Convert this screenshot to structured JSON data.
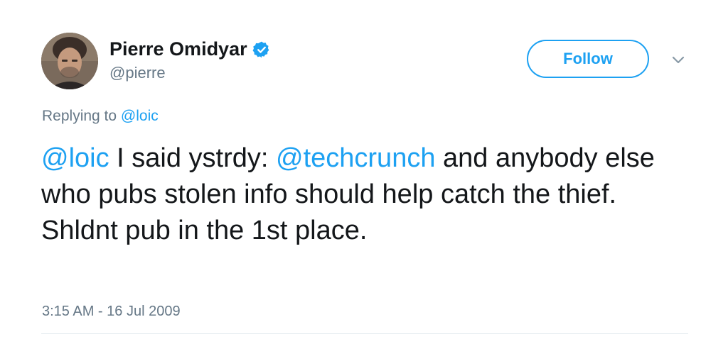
{
  "author": {
    "name": "Pierre Omidyar",
    "handle": "@pierre",
    "verified": true
  },
  "follow_button": {
    "label": "Follow"
  },
  "icons": {
    "verified": "verified-badge-icon",
    "caret": "chevron-down-icon",
    "avatar": "profile-photo"
  },
  "reply": {
    "prefix": "Replying to ",
    "mention": "@loic"
  },
  "tweet": {
    "segments": [
      {
        "text": "@loic",
        "type": "mention"
      },
      {
        "text": " I said ystrdy: ",
        "type": "text"
      },
      {
        "text": "@techcrunch",
        "type": "mention"
      },
      {
        "text": " and anybody else who pubs stolen info should help catch the thief. Shldnt pub in the 1st place.",
        "type": "text"
      }
    ]
  },
  "timestamp": "3:15 AM - 16 Jul 2009",
  "colors": {
    "accent": "#1da1f2",
    "secondary_text": "#657786",
    "primary_text": "#14171a",
    "divider": "#e6ecf0"
  }
}
